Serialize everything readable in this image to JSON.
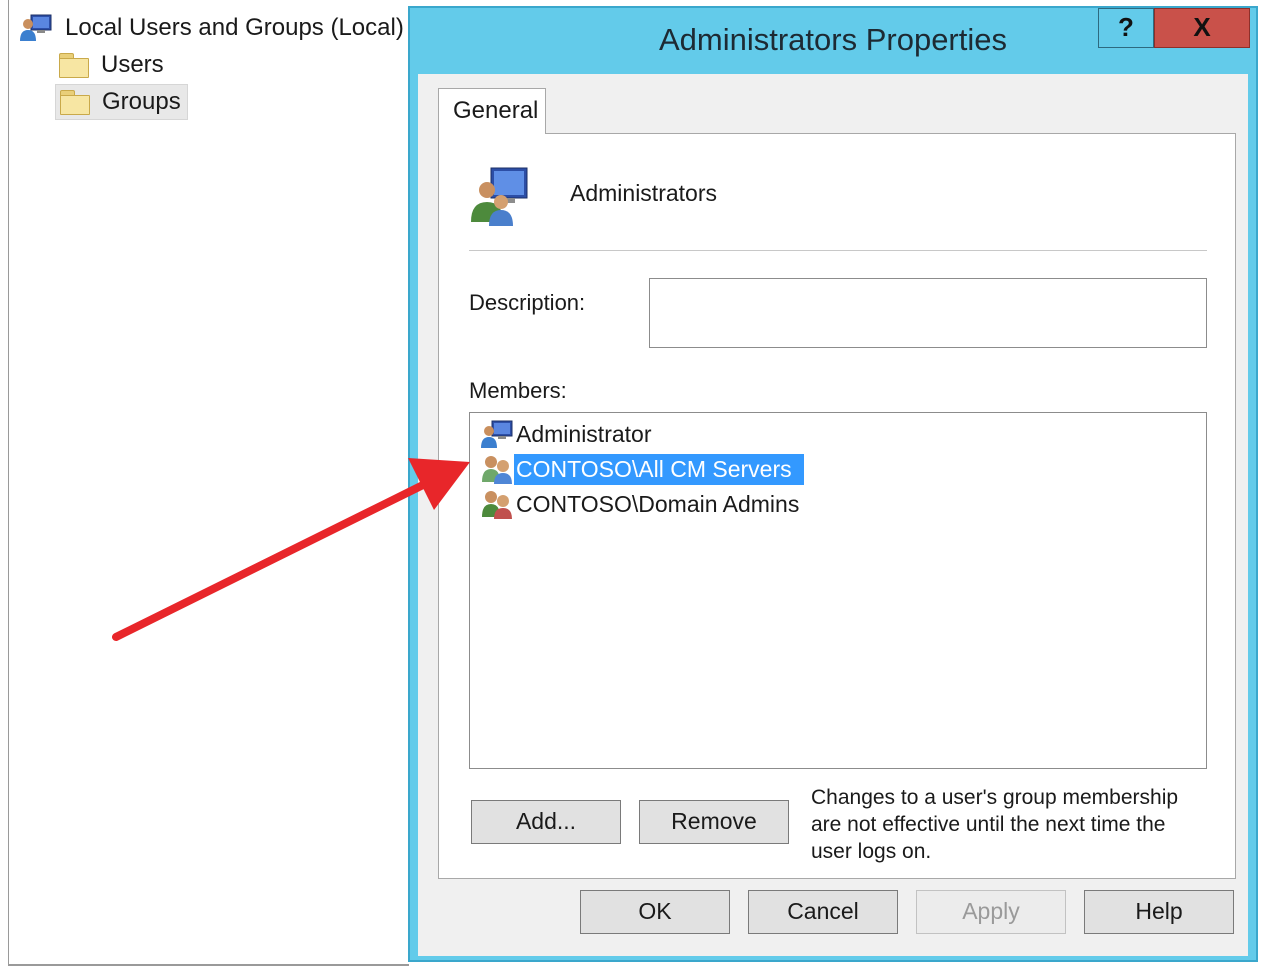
{
  "tree": {
    "root_label": "Local Users and Groups (Local)",
    "root_icon": "users-computer-icon",
    "items": [
      {
        "label": "Users",
        "icon": "folder-icon",
        "selected": false
      },
      {
        "label": "Groups",
        "icon": "folder-icon",
        "selected": true
      }
    ]
  },
  "dialog": {
    "title": "Administrators Properties",
    "help_label": "?",
    "close_label": "X",
    "tabs": [
      {
        "label": "General",
        "active": true
      }
    ],
    "group_name": "Administrators",
    "group_icon": "group-computer-icon",
    "description_label": "Description:",
    "description_value": "",
    "members_label": "Members:",
    "members": [
      {
        "name": "Administrator",
        "icon": "user-computer-icon",
        "selected": false
      },
      {
        "name": "CONTOSO\\All CM Servers",
        "icon": "group-icon",
        "selected": true
      },
      {
        "name": "CONTOSO\\Domain Admins",
        "icon": "group-icon",
        "selected": false
      }
    ],
    "add_label": "Add...",
    "remove_label": "Remove",
    "note": "Changes to a user's group membership are not effective until the next time the user logs on.",
    "ok_label": "OK",
    "cancel_label": "Cancel",
    "apply_label": "Apply",
    "help_button_label": "Help"
  },
  "annotation": {
    "type": "red-arrow",
    "color": "#e8262a"
  },
  "colors": {
    "titlebar": "#63cbea",
    "close_button": "#c9514a",
    "selection": "#3399ff"
  }
}
